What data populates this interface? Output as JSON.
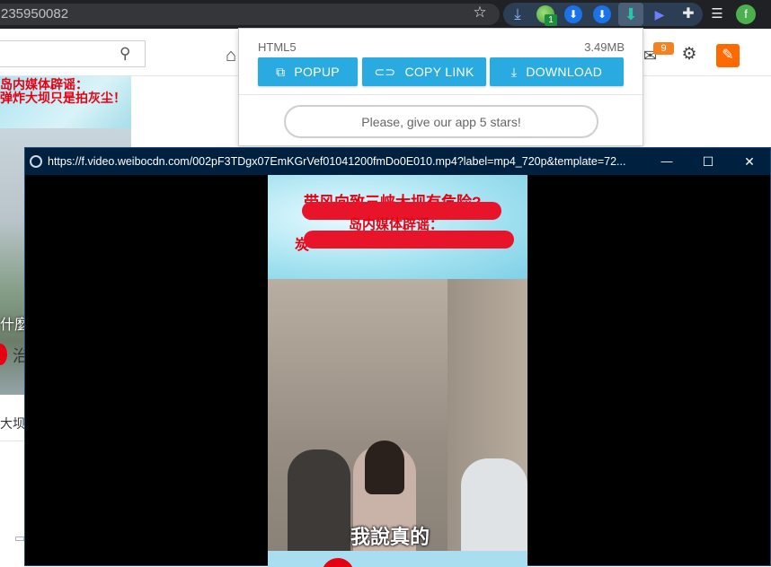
{
  "browser": {
    "url_fragment": "235950082",
    "profile_initial": "f",
    "extension_badge": "1",
    "icons": [
      "star-icon",
      "download-arrow-icon",
      "globe-badge-icon",
      "download-circle-icon",
      "download-circle-icon-2",
      "video-downloader-icon",
      "play-icon",
      "puzzle-icon",
      "reading-list-icon",
      "profile-avatar"
    ]
  },
  "page": {
    "notification_count": "9",
    "article_headline_line1": "岛内媒体辟谣：",
    "article_headline_line2": "弹炸大坝只是拍灰尘！",
    "caption_fragment": "什麼",
    "author_fragment": "治",
    "list_fragment": "大坝"
  },
  "popup": {
    "format": "HTML5",
    "size": "3.49MB",
    "buttons": {
      "popup": "POPUP",
      "copy_link": "COPY LINK",
      "download": "DOWNLOAD"
    },
    "rate_prompt": "Please, give our app 5 stars!"
  },
  "video_window": {
    "url": "https://f.video.weibocdn.com/002pF3TDgx07EmKGrVef01041200fmDo0E010.mp4?label=mp4_720p&template=72...",
    "minimize": "—",
    "maximize": "☐",
    "close": "✕",
    "banner_line1_fragment": "带风向致三峡大坝有危险?",
    "banner_line2": "岛内媒体辟谣：",
    "banner_line3_fragment": "炭",
    "subtitle": "我說真的"
  },
  "colors": {
    "accent": "#29abe2",
    "title_bar": "#002040",
    "notification": "#f58220",
    "edit_button": "#ff6a00",
    "redaction": "#e8142a"
  }
}
